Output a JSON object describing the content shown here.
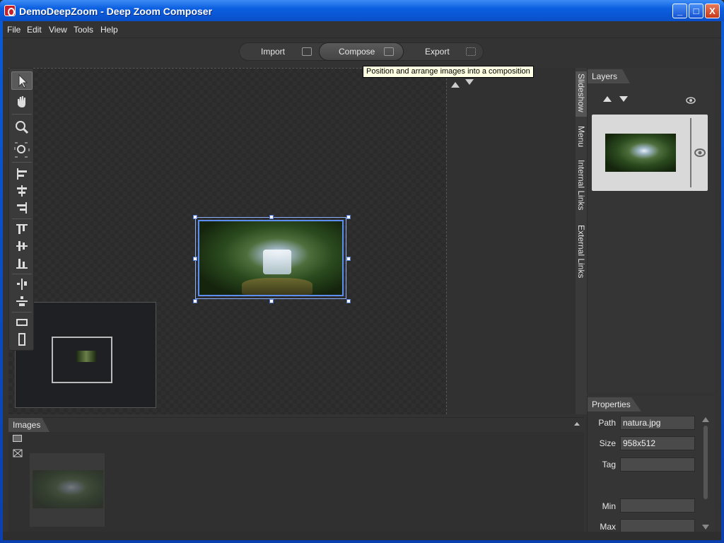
{
  "window": {
    "title": "DemoDeepZoom - Deep Zoom Composer",
    "minimize": "_",
    "maximize": "□",
    "close": "X"
  },
  "menu": [
    "File",
    "Edit",
    "View",
    "Tools",
    "Help"
  ],
  "modes": {
    "import": "Import",
    "compose": "Compose",
    "export": "Export"
  },
  "tooltip": "Position and arrange images into a composition",
  "side_tabs": [
    "Slideshow",
    "Menu",
    "Internal Links",
    "External Links"
  ],
  "layers": {
    "title": "Layers"
  },
  "properties": {
    "title": "Properties",
    "path_label": "Path",
    "path_value": "natura.jpg",
    "size_label": "Size",
    "size_value": "958x512",
    "tag_label": "Tag",
    "tag_value": "",
    "min_label": "Min",
    "min_value": "",
    "max_label": "Max",
    "max_value": ""
  },
  "images": {
    "title": "Images"
  },
  "icons": [
    "select-arrow-icon",
    "hand-pan-icon",
    "zoom-icon",
    "zoom-fit-icon",
    "align-left-icon",
    "align-center-icon",
    "align-right-icon",
    "align-top-icon",
    "align-middle-icon",
    "align-bottom-icon",
    "distribute-horizontal-icon",
    "distribute-vertical-icon",
    "resize-width-icon",
    "resize-height-icon",
    "eye-icon",
    "arrow-up-icon",
    "arrow-down-icon"
  ],
  "colors": {
    "titlebar": "#0a5bd8",
    "selection": "#5b8ef0",
    "tooltip_bg": "#ffffe1"
  }
}
